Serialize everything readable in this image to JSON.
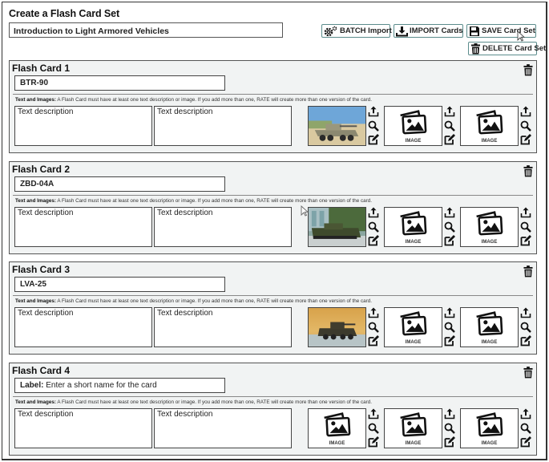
{
  "page": {
    "title": "Create a Flash Card Set",
    "set_name": "Introduction to Light Armored Vehicles"
  },
  "toolbar": {
    "batch_import": "BATCH Import",
    "import_cards": "IMPORT Cards",
    "save_set": "SAVE Card Set",
    "delete_set": "DELETE Card Set"
  },
  "common": {
    "help_bold": "Text and Images:",
    "help_text": " A Flash Card must have at least one text description or image. If you add more than one, RATE will create more than one version of the card.",
    "text_placeholder": "Text description",
    "image_placeholder": "IMAGE",
    "label_prefix": "Label:",
    "label_placeholder": " Enter a short name for the card"
  },
  "cards": [
    {
      "title": "Flash Card 1",
      "label": "BTR-90",
      "text1": "",
      "text2": "",
      "images": [
        "photo: BTR-90 armored vehicle on sand",
        "empty",
        "empty"
      ]
    },
    {
      "title": "Flash Card 2",
      "label": "ZBD-04A",
      "text1": "",
      "text2": "",
      "images": [
        "photo: ZBD-04A vehicle in front of building",
        "empty",
        "empty"
      ]
    },
    {
      "title": "Flash Card 3",
      "label": "LVA-25",
      "text1": "",
      "text2": "",
      "images": [
        "photo: LAV-25 in desert",
        "empty",
        "empty"
      ]
    },
    {
      "title": "Flash Card 4",
      "label": "",
      "text1": "",
      "text2": "",
      "images": [
        "empty",
        "empty",
        "empty"
      ]
    }
  ],
  "icons": {
    "batch": "gears-icon",
    "import": "download-icon",
    "save": "floppy-disk-icon",
    "delete": "trash-icon",
    "upload": "upload-icon",
    "zoom": "magnifier-icon",
    "edit": "edit-icon",
    "image_placeholder": "image-stack-icon"
  },
  "colors": {
    "button_border": "#5b8c8c",
    "card_background": "#f1f3f3",
    "border": "#444444"
  }
}
